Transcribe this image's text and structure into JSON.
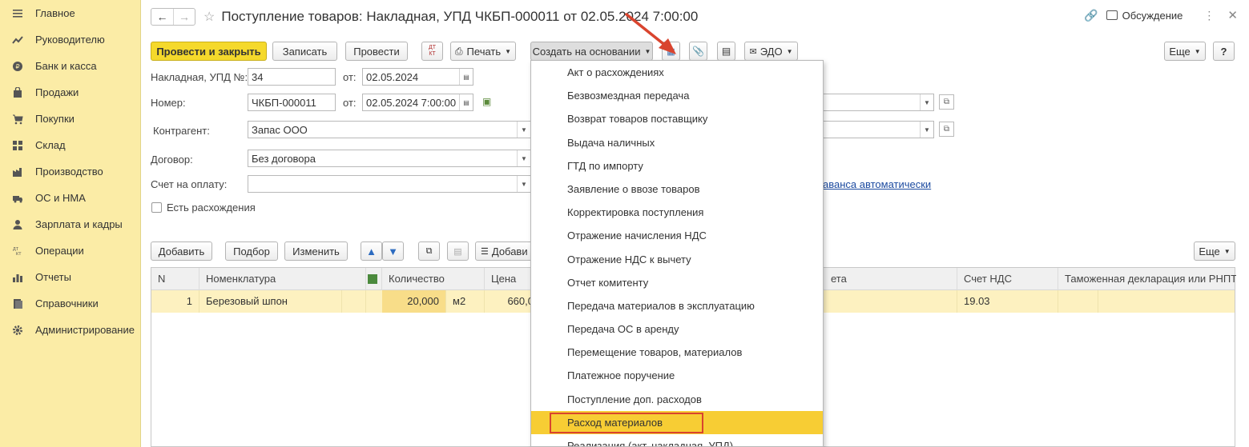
{
  "sidebar": {
    "items": [
      {
        "label": "Главное",
        "icon": "menu-icon"
      },
      {
        "label": "Руководителю",
        "icon": "trend-icon"
      },
      {
        "label": "Банк и касса",
        "icon": "coin-icon"
      },
      {
        "label": "Продажи",
        "icon": "bag-icon"
      },
      {
        "label": "Покупки",
        "icon": "cart-icon"
      },
      {
        "label": "Склад",
        "icon": "grid-icon"
      },
      {
        "label": "Производство",
        "icon": "factory-icon"
      },
      {
        "label": "ОС и НМА",
        "icon": "truck-icon"
      },
      {
        "label": "Зарплата и кадры",
        "icon": "person-icon"
      },
      {
        "label": "Операции",
        "icon": "dt-kt-icon"
      },
      {
        "label": "Отчеты",
        "icon": "bar-chart-icon"
      },
      {
        "label": "Справочники",
        "icon": "book-icon"
      },
      {
        "label": "Администрирование",
        "icon": "gear-icon"
      }
    ]
  },
  "header": {
    "title": "Поступление товаров: Накладная, УПД ЧКБП-000011 от 02.05.2024 7:00:00",
    "discussion": "Обсуждение"
  },
  "toolbar": {
    "post_close": "Провести и закрыть",
    "save": "Записать",
    "post": "Провести",
    "dtkt": "Дт Кт",
    "print": "Печать",
    "create_based": "Создать на основании",
    "edo": "ЭДО",
    "more": "Еще",
    "help": "?"
  },
  "form": {
    "invoice_label": "Накладная, УПД №:",
    "invoice_value": "34",
    "from_label": "от:",
    "invoice_date": "02.05.2024",
    "number_label": "Номер:",
    "number_value": "ЧКБП-000011",
    "number_date": "02.05.2024  7:00:00",
    "contractor_label": "Контрагент:",
    "contractor_value": "Запас ООО",
    "contract_label": "Договор:",
    "contract_value": "Без договора",
    "payment_label": "Счет на оплату:",
    "payment_value": "",
    "discrepancy_label": "Есть расхождения",
    "advance_link": "аванса автоматически"
  },
  "table_toolbar": {
    "add": "Добавить",
    "pick": "Подбор",
    "edit": "Изменить",
    "add_bar": "Добави",
    "more": "Еще"
  },
  "table": {
    "columns": [
      "N",
      "Номенклатура",
      "Количество",
      "Цена",
      "ета",
      "Счет НДС",
      "Таможенная декларация или РНПТ"
    ],
    "rows": [
      {
        "n": "1",
        "item": "Березовый шпон",
        "qty": "20,000",
        "unit": "м2",
        "price": "660,0",
        "account": "",
        "vat_account": "19.03",
        "customs": ""
      }
    ]
  },
  "menu": {
    "items": [
      "Акт о расхождениях",
      "Безвозмездная передача",
      "Возврат товаров поставщику",
      "Выдача наличных",
      "ГТД по импорту",
      "Заявление о ввозе товаров",
      "Корректировка поступления",
      "Отражение начисления НДС",
      "Отражение НДС к вычету",
      "Отчет комитенту",
      "Передача материалов в эксплуатацию",
      "Передача ОС в аренду",
      "Перемещение товаров, материалов",
      "Платежное поручение",
      "Поступление доп. расходов",
      "Расход материалов",
      "Реализация (акт, накладная, УПД)"
    ],
    "selected_index": 15
  },
  "colors": {
    "sidebar_bg": "#fbeca6",
    "primary_btn": "#f5d92b",
    "row_highlight": "#fdf1c0",
    "menu_selected": "#f7cd34",
    "annotation_red": "#d9442e",
    "link": "#1d4ba0"
  }
}
